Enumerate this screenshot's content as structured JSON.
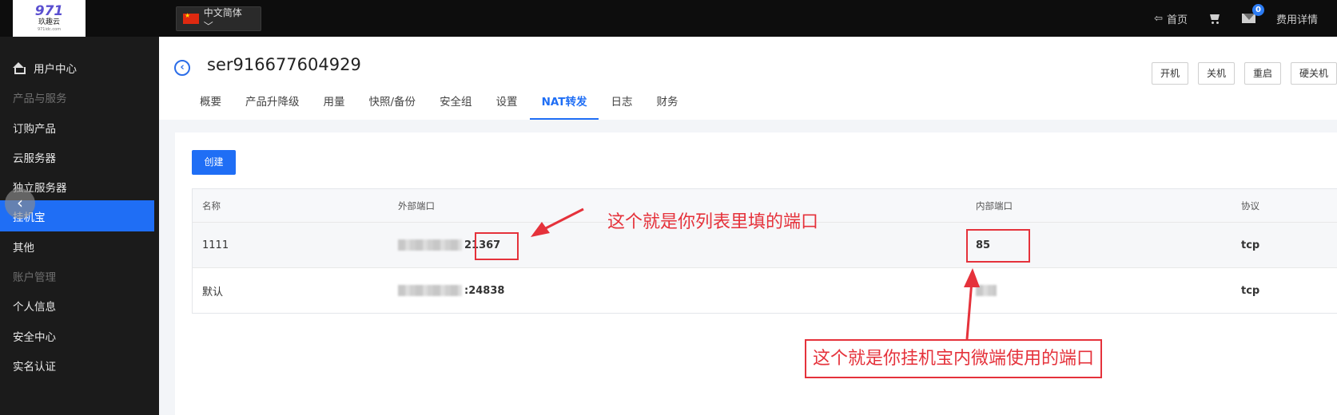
{
  "topbar": {
    "logo": {
      "mark": "971",
      "name": "玖趣云",
      "url": "971idc.com"
    },
    "language": "中文简体 ﹀",
    "home": "首页",
    "mail_count": "0",
    "billing": "费用详情"
  },
  "sidebar": {
    "items": [
      {
        "label": "用户中心",
        "type": "item",
        "icon": "home-icon"
      },
      {
        "label": "产品与服务",
        "type": "group"
      },
      {
        "label": "订购产品",
        "type": "item"
      },
      {
        "label": "云服务器",
        "type": "item"
      },
      {
        "label": "独立服务器",
        "type": "item"
      },
      {
        "label": "挂机宝",
        "type": "item",
        "active": true
      },
      {
        "label": "其他",
        "type": "item"
      },
      {
        "label": "账户管理",
        "type": "group"
      },
      {
        "label": "个人信息",
        "type": "item"
      },
      {
        "label": "安全中心",
        "type": "item"
      },
      {
        "label": "实名认证",
        "type": "item"
      }
    ],
    "collapse_glyph": "‹"
  },
  "header": {
    "back_glyph": "‹",
    "server_name": "ser916677604929",
    "tabs": [
      "概要",
      "产品升降级",
      "用量",
      "快照/备份",
      "安全组",
      "设置",
      "NAT转发",
      "日志",
      "财务"
    ],
    "active_tab": "NAT转发",
    "actions": [
      "开机",
      "关机",
      "重启",
      "硬关机"
    ]
  },
  "nat": {
    "create_label": "创建",
    "columns": [
      "名称",
      "外部端口",
      "内部端口",
      "协议"
    ],
    "rows": [
      {
        "name": "1111",
        "external_port": "21367",
        "internal_port": "85",
        "protocol": "tcp"
      },
      {
        "name": "默认",
        "external_port": ":24838",
        "internal_port": "",
        "protocol": "tcp"
      }
    ]
  },
  "annotations": {
    "external_note": "这个就是你列表里填的端口",
    "internal_note": "这个就是你挂机宝内微端使用的端口",
    "color": "#e5323b"
  },
  "colors": {
    "accent": "#1f6ef5",
    "sidebar": "#1b1b1b",
    "topbar": "#0d0d0d"
  }
}
